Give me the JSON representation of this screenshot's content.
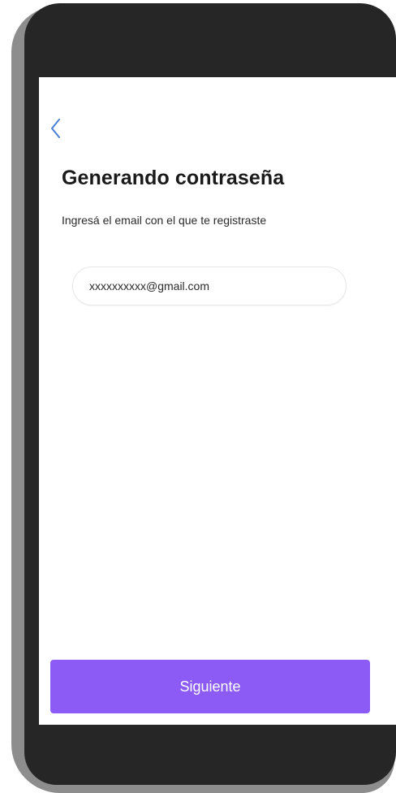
{
  "colors": {
    "accent": "#8c5af5",
    "back_icon": "#4a7fd6",
    "phone_frame": "#262626",
    "phone_shadow": "#8d8d8d"
  },
  "header": {
    "back_icon": "chevron-left-icon",
    "title": "Generando contraseña",
    "subtitle": "Ingresá el email con el que te registraste"
  },
  "form": {
    "email_value": "xxxxxxxxxx@gmail.com"
  },
  "footer": {
    "next_label": "Siguiente"
  }
}
